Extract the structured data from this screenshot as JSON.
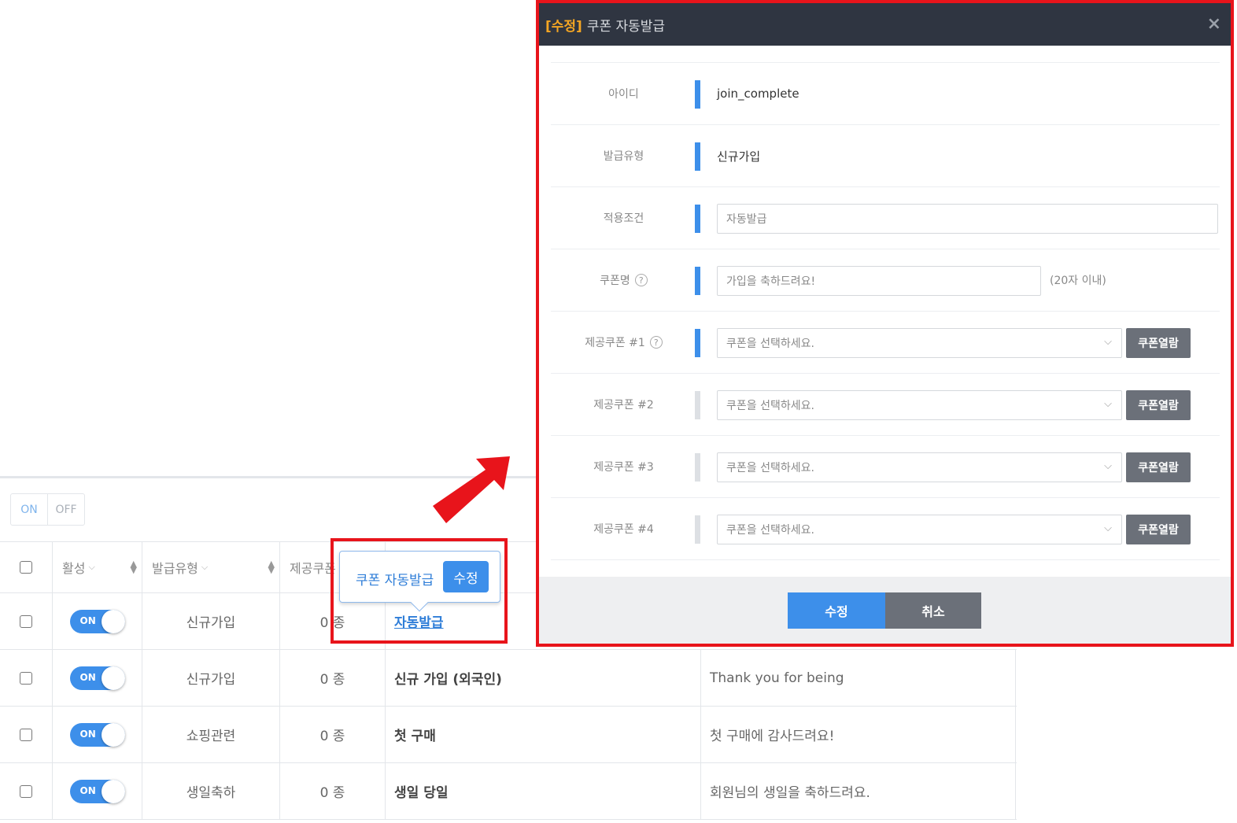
{
  "filter": {
    "on_label": "ON",
    "off_label": "OFF"
  },
  "table": {
    "headers": {
      "active": "활성",
      "type": "발급유형",
      "count": "제공쿠폰"
    },
    "rows": [
      {
        "toggle": "ON",
        "type": "신규가입",
        "count": "0 종",
        "name": "자동발급",
        "message": ""
      },
      {
        "toggle": "ON",
        "type": "신규가입",
        "count": "0 종",
        "name": "신규 가입 (외국인)",
        "message": "Thank you for being"
      },
      {
        "toggle": "ON",
        "type": "쇼핑관련",
        "count": "0 종",
        "name": "첫 구매",
        "message": "첫 구매에 감사드려요!"
      },
      {
        "toggle": "ON",
        "type": "생일축하",
        "count": "0 종",
        "name": "생일 당일",
        "message": "회원님의 생일을 축하드려요."
      }
    ]
  },
  "tooltip": {
    "text": "쿠폰 자동발급",
    "button": "수정"
  },
  "modal": {
    "tag": "[수정]",
    "title": "쿠폰 자동발급",
    "close": "×",
    "fields": {
      "id_label": "아이디",
      "id_value": "join_complete",
      "type_label": "발급유형",
      "type_value": "신규가입",
      "condition_label": "적용조건",
      "condition_value": "자동발급",
      "coupon_name_label": "쿠폰명",
      "coupon_name_value": "가입을 축하드려요!",
      "coupon_name_hint": "(20자 이내)",
      "coupons": [
        {
          "label": "제공쿠폰 #1",
          "placeholder": "쿠폰을 선택하세요.",
          "button": "쿠폰열람"
        },
        {
          "label": "제공쿠폰 #2",
          "placeholder": "쿠폰을 선택하세요.",
          "button": "쿠폰열람"
        },
        {
          "label": "제공쿠폰 #3",
          "placeholder": "쿠폰을 선택하세요.",
          "button": "쿠폰열람"
        },
        {
          "label": "제공쿠폰 #4",
          "placeholder": "쿠폰을 선택하세요.",
          "button": "쿠폰열람"
        }
      ]
    },
    "footer": {
      "submit": "수정",
      "cancel": "취소"
    }
  },
  "colors": {
    "accent": "#3d8fea",
    "highlight": "#e8141b",
    "header_bg": "#2f3541",
    "tag": "#f5a623"
  }
}
